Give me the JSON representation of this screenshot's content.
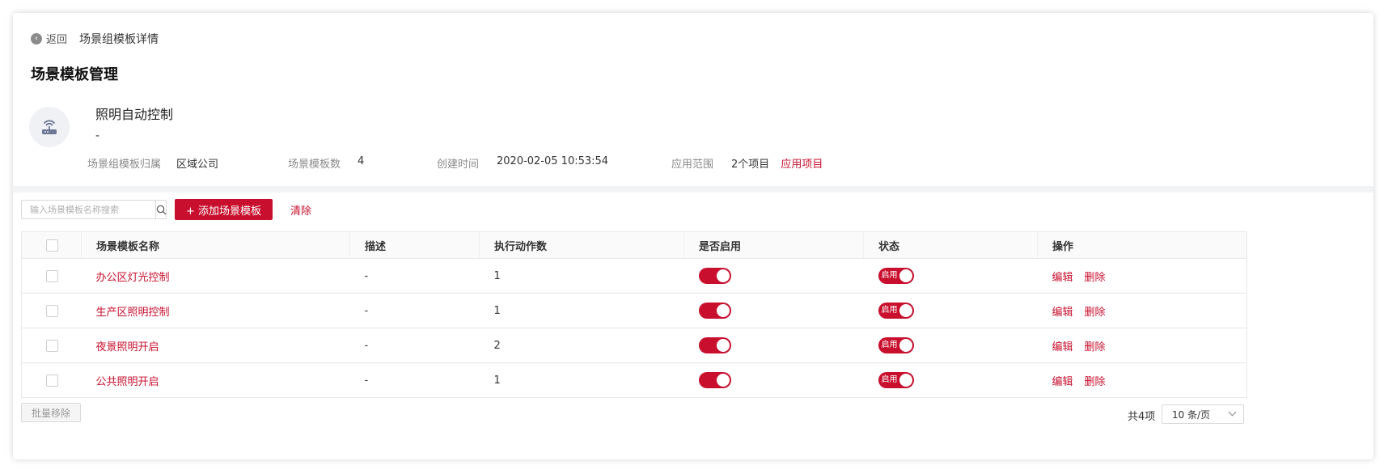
{
  "header": {
    "back_label": "返回",
    "breadcrumb_title": "场景组模板详情",
    "page_title": "场景模板管理"
  },
  "detail": {
    "name": "照明自动控制",
    "description": "-",
    "meta": [
      {
        "label": "场景组模板归属",
        "value": "区域公司"
      },
      {
        "label": "场景模板数",
        "value": "4"
      },
      {
        "label": "创建时间",
        "value": "2020-02-05 10:53:54"
      },
      {
        "label": "应用范围",
        "value": "2个项目",
        "link": "应用项目"
      }
    ]
  },
  "toolbar": {
    "search_placeholder": "输入场景模板名称搜索",
    "add_label": "+ 添加场景模板",
    "clear_label": "清除"
  },
  "table": {
    "columns": [
      "场景模板名称",
      "描述",
      "执行动作数",
      "是否启用",
      "状态",
      "操作"
    ],
    "rows": [
      {
        "name": "办公区灯光控制",
        "desc": "-",
        "actions": "1",
        "enabled": true,
        "status": "启用",
        "edit": "编辑",
        "delete": "删除"
      },
      {
        "name": "生产区照明控制",
        "desc": "-",
        "actions": "1",
        "enabled": true,
        "status": "启用",
        "edit": "编辑",
        "delete": "删除"
      },
      {
        "name": "夜景照明开启",
        "desc": "-",
        "actions": "2",
        "enabled": true,
        "status": "启用",
        "edit": "编辑",
        "delete": "删除"
      },
      {
        "name": "公共照明开启",
        "desc": "-",
        "actions": "1",
        "enabled": true,
        "status": "启用",
        "edit": "编辑",
        "delete": "删除"
      }
    ]
  },
  "footer": {
    "batch_remove_label": "批量移除",
    "total_label": "共4项",
    "page_size_label": "10 条/页"
  },
  "colors": {
    "accent": "#c8102e"
  }
}
